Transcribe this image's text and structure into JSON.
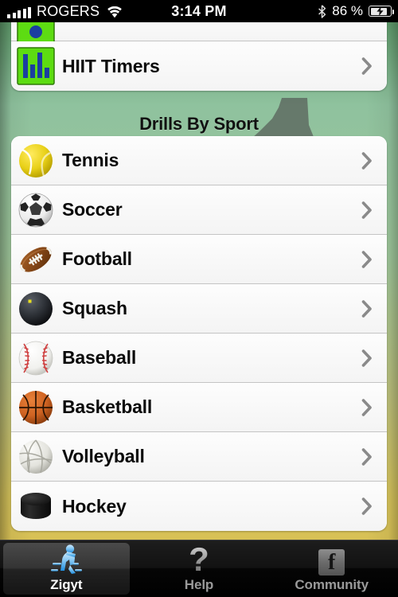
{
  "status_bar": {
    "carrier": "ROGERS",
    "wifi_icon": "wifi-icon",
    "time": "3:14 PM",
    "bluetooth_icon": "bluetooth-icon",
    "battery_percent": "86 %",
    "battery_icon": "battery-charging-icon"
  },
  "top_group": {
    "partial_row": {
      "label": "",
      "icon": "green-timer-icon"
    },
    "rows": [
      {
        "label": "HIIT Timers",
        "icon": "bar-chart-icon",
        "chevron": "chevron-right-icon"
      }
    ]
  },
  "section": {
    "header": "Drills By Sport",
    "watermark_icon": "shoe-silhouette-icon"
  },
  "sports": [
    {
      "label": "Tennis",
      "icon": "tennis-ball-icon",
      "chevron": "chevron-right-icon"
    },
    {
      "label": "Soccer",
      "icon": "soccer-ball-icon",
      "chevron": "chevron-right-icon"
    },
    {
      "label": "Football",
      "icon": "football-icon",
      "chevron": "chevron-right-icon"
    },
    {
      "label": "Squash",
      "icon": "squash-ball-icon",
      "chevron": "chevron-right-icon"
    },
    {
      "label": "Baseball",
      "icon": "baseball-icon",
      "chevron": "chevron-right-icon"
    },
    {
      "label": "Basketball",
      "icon": "basketball-icon",
      "chevron": "chevron-right-icon"
    },
    {
      "label": "Volleyball",
      "icon": "volleyball-icon",
      "chevron": "chevron-right-icon"
    },
    {
      "label": "Hockey",
      "icon": "hockey-puck-icon",
      "chevron": "chevron-right-icon"
    }
  ],
  "tab_bar": {
    "tabs": [
      {
        "label": "Zigyt",
        "icon": "runner-icon",
        "active": true
      },
      {
        "label": "Help",
        "icon": "question-mark-icon",
        "active": false
      },
      {
        "label": "Community",
        "icon": "facebook-icon",
        "active": false
      }
    ]
  },
  "colors": {
    "background_top": "#5f9b6b",
    "background_mid": "#9ec69a",
    "background_bottom": "#d8c156",
    "row_background": "#f7f7f7",
    "chevron": "#8a8a8a",
    "tab_active_label": "#ffffff",
    "tab_inactive_label": "#9a9a9a",
    "accent_green_icon": "#5ddc12",
    "accent_blue_icon": "#1a3fa0"
  }
}
